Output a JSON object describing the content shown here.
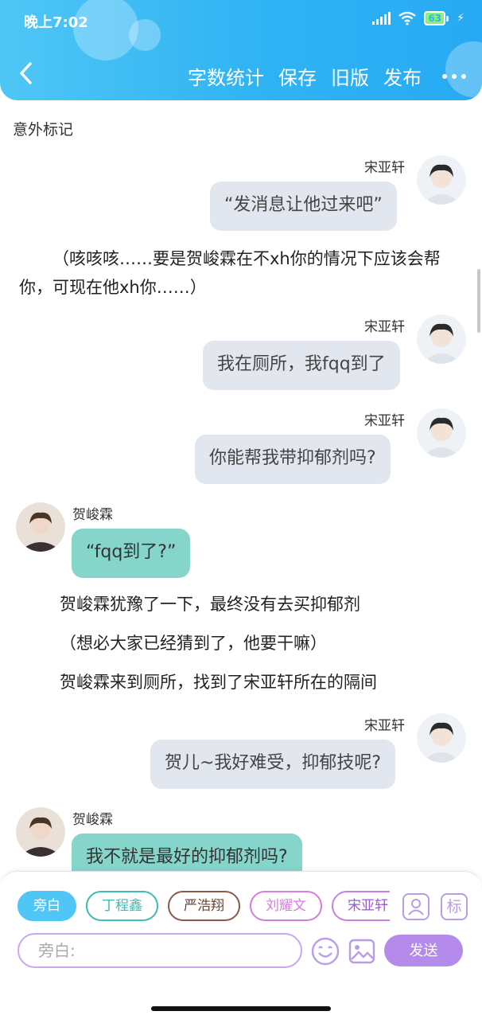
{
  "status_bar": {
    "time": "晚上7:02",
    "battery": "63"
  },
  "toolbar": {
    "word_count": "字数统计",
    "save": "保存",
    "old_version": "旧版",
    "publish": "发布"
  },
  "story": {
    "title": "意外标记"
  },
  "messages": [
    {
      "speaker": "宋亚轩",
      "text": "“发消息让他过来吧”"
    },
    {
      "narration": "（咳咳咳……要是贺峻霖在不xh你的情况下应该会帮你，可现在他xh你……）"
    },
    {
      "speaker": "宋亚轩",
      "text": "我在厕所，我fqq到了"
    },
    {
      "speaker": "宋亚轩",
      "text": "你能帮我带抑郁剂吗?"
    },
    {
      "speaker": "贺峻霖",
      "text": "“fqq到了?”"
    },
    {
      "narration": "贺峻霖犹豫了一下，最终没有去买抑郁剂"
    },
    {
      "narration": "（想必大家已经猜到了，他要干嘛）"
    },
    {
      "narration": "贺峻霖来到厕所，找到了宋亚轩所在的隔间"
    },
    {
      "speaker": "宋亚轩",
      "text": "贺儿~我好难受，抑郁技呢?"
    },
    {
      "speaker": "贺峻霖",
      "text": "我不就是最好的抑郁剂吗?"
    }
  ],
  "roles": [
    {
      "label": "旁白",
      "color": "#4fc6f5"
    },
    {
      "label": "丁程鑫",
      "color": "#3cbcb4"
    },
    {
      "label": "严浩翔",
      "color": "#8b5a4a"
    },
    {
      "label": "刘耀文",
      "color": "#d77be0"
    },
    {
      "label": "宋亚轩",
      "color": "#c880e6"
    }
  ],
  "composer": {
    "placeholder": "旁白:",
    "send": "发送",
    "mark_icon_label": "标"
  },
  "colors": {
    "header": "#2fb3f4",
    "right_bubble": "#e2e6ee",
    "left_bubble": "#85d5cb",
    "send_button": "#b48bea"
  }
}
